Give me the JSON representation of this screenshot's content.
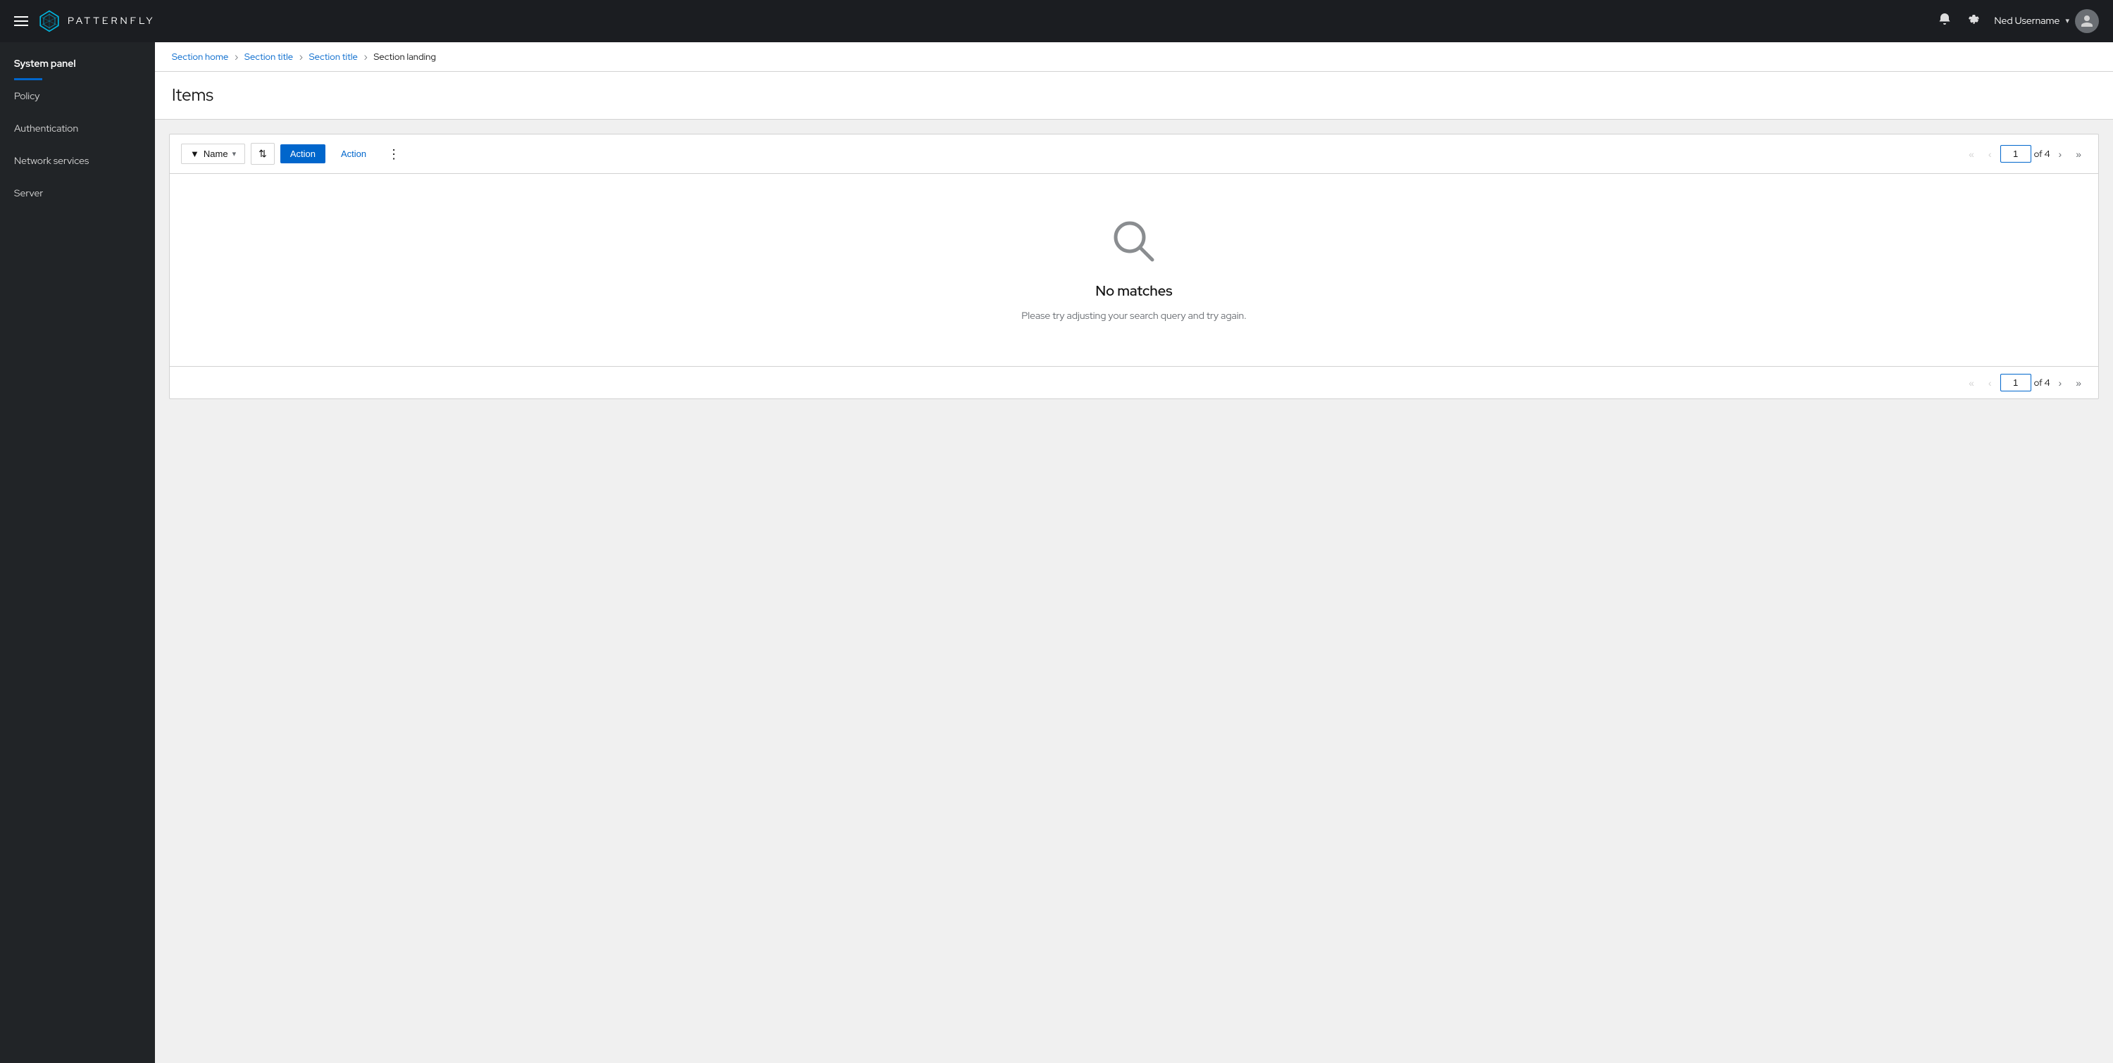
{
  "app": {
    "name": "PATTERNFLY"
  },
  "topnav": {
    "username": "Ned Username",
    "notification_icon": "🔔",
    "settings_icon": "⚙"
  },
  "sidebar": {
    "title": "System panel",
    "items": [
      {
        "id": "policy",
        "label": "Policy",
        "active": false
      },
      {
        "id": "authentication",
        "label": "Authentication",
        "active": false
      },
      {
        "id": "network-services",
        "label": "Network services",
        "active": false
      },
      {
        "id": "server",
        "label": "Server",
        "active": false
      }
    ]
  },
  "breadcrumb": {
    "crumbs": [
      {
        "label": "Section home",
        "link": true
      },
      {
        "label": "Section title",
        "link": true
      },
      {
        "label": "Section title",
        "link": true
      },
      {
        "label": "Section landing",
        "link": false
      }
    ]
  },
  "page": {
    "title": "Items"
  },
  "toolbar": {
    "filter_label": "Name",
    "filter_icon": "▼",
    "sort_icon": "⇅",
    "action_primary": "Action",
    "action_secondary": "Action",
    "kebab": "⋮",
    "pagination": {
      "current_page": "1",
      "total_pages": "4",
      "of_label": "of 4"
    }
  },
  "empty_state": {
    "icon": "🔍",
    "title": "No matches",
    "description": "Please try adjusting your search query and try again."
  }
}
